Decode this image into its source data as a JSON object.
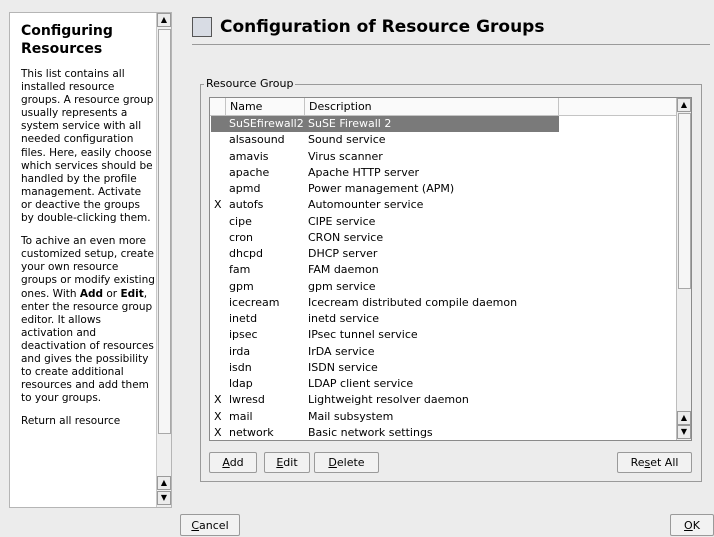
{
  "help": {
    "title": "Configuring Resources",
    "para1": "This list contains all installed resource groups. A resource group usually represents a system service with all needed configuration files. Here, easily choose which services should be handled by the profile management. Activate or deactive the groups by double-clicking them.",
    "para2_prefix": "To achive an even more customized setup, create your own resource groups or modify existing ones. With ",
    "para2_add": "Add",
    "para2_or": " or ",
    "para2_edit": "Edit",
    "para2_suffix": ", enter the resource group editor. It allows activation and deactivation of resources and gives the possibility to create additional resources and add them to your groups.",
    "para3": "Return all resource"
  },
  "dialog": {
    "title": "Configuration of Resource Groups",
    "group_label": "Resource Group"
  },
  "table": {
    "columns": {
      "name": "Name",
      "description": "Description"
    },
    "rows": [
      {
        "mark": "",
        "name": "SuSEfirewall2",
        "description": "SuSE Firewall 2",
        "selected": true
      },
      {
        "mark": "",
        "name": "alsasound",
        "description": "Sound service"
      },
      {
        "mark": "",
        "name": "amavis",
        "description": "Virus scanner"
      },
      {
        "mark": "",
        "name": "apache",
        "description": "Apache HTTP server"
      },
      {
        "mark": "",
        "name": "apmd",
        "description": "Power management (APM)"
      },
      {
        "mark": "X",
        "name": "autofs",
        "description": "Automounter service"
      },
      {
        "mark": "",
        "name": "cipe",
        "description": "CIPE service"
      },
      {
        "mark": "",
        "name": "cron",
        "description": "CRON service"
      },
      {
        "mark": "",
        "name": "dhcpd",
        "description": "DHCP server"
      },
      {
        "mark": "",
        "name": "fam",
        "description": "FAM daemon"
      },
      {
        "mark": "",
        "name": "gpm",
        "description": "gpm service"
      },
      {
        "mark": "",
        "name": "icecream",
        "description": "Icecream distributed compile daemon"
      },
      {
        "mark": "",
        "name": "inetd",
        "description": "inetd service"
      },
      {
        "mark": "",
        "name": "ipsec",
        "description": "IPsec tunnel service"
      },
      {
        "mark": "",
        "name": "irda",
        "description": "IrDA service"
      },
      {
        "mark": "",
        "name": "isdn",
        "description": "ISDN service"
      },
      {
        "mark": "",
        "name": "ldap",
        "description": "LDAP client service"
      },
      {
        "mark": "X",
        "name": "lwresd",
        "description": "Lightweight resolver daemon"
      },
      {
        "mark": "X",
        "name": "mail",
        "description": "Mail subsystem"
      },
      {
        "mark": "X",
        "name": "network",
        "description": "Basic network settings"
      }
    ]
  },
  "buttons": {
    "add": {
      "accel": "A",
      "rest": "dd"
    },
    "edit": {
      "accel": "E",
      "rest": "dit"
    },
    "delete": {
      "accel": "D",
      "rest": "elete"
    },
    "reset_all": {
      "pre": "Re",
      "accel": "s",
      "rest": "et All"
    },
    "cancel": {
      "accel": "C",
      "rest": "ancel"
    },
    "ok": {
      "accel": "O",
      "rest": "K"
    }
  },
  "icons": {
    "dialog": "config-dialog-icon",
    "scroll_up": "arrow-up-icon",
    "scroll_down": "arrow-down-icon"
  }
}
